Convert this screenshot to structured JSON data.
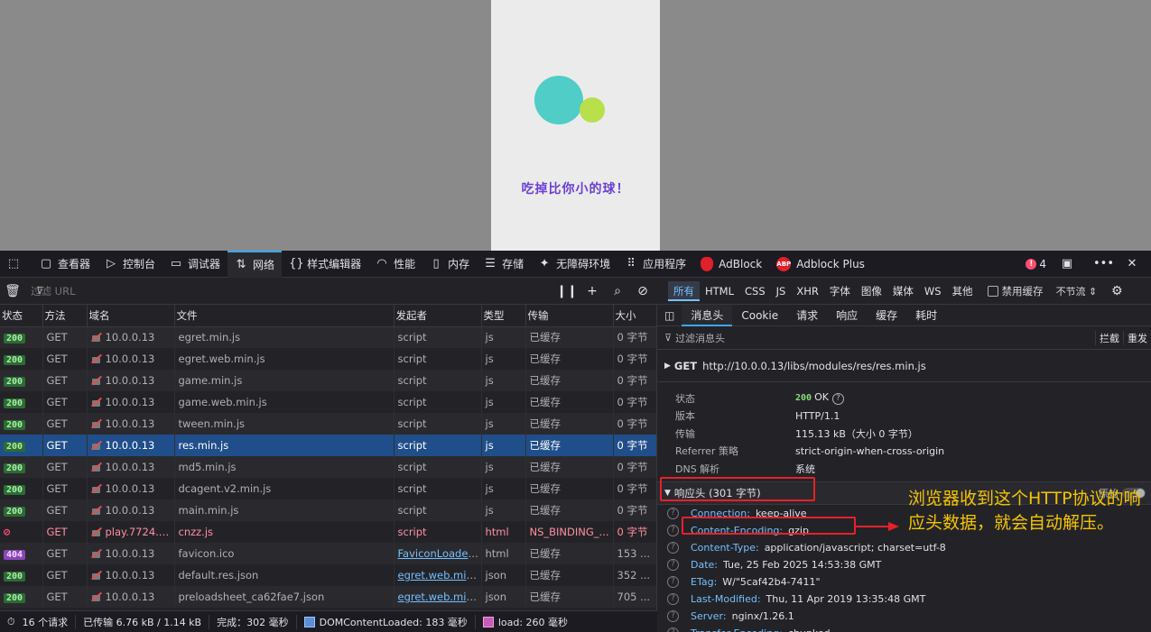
{
  "viewport": {
    "game_caption": "吃掉比你小的球！"
  },
  "toolbar": {
    "items": [
      {
        "label": "查看器",
        "icon": "inspector-icon"
      },
      {
        "label": "控制台",
        "icon": "console-icon"
      },
      {
        "label": "调试器",
        "icon": "debugger-icon"
      },
      {
        "label": "网络",
        "icon": "network-icon"
      },
      {
        "label": "样式编辑器",
        "icon": "style-editor-icon"
      },
      {
        "label": "性能",
        "icon": "performance-icon"
      },
      {
        "label": "内存",
        "icon": "memory-icon"
      },
      {
        "label": "存储",
        "icon": "storage-icon"
      },
      {
        "label": "无障碍环境",
        "icon": "accessibility-icon"
      },
      {
        "label": "应用程序",
        "icon": "application-icon"
      },
      {
        "label": "AdBlock",
        "icon": "adblock-icon"
      },
      {
        "label": "Adblock Plus",
        "icon": "adblock-plus-icon"
      }
    ],
    "abp_badge": "ABP",
    "error_count": "4"
  },
  "filterbar": {
    "placeholder": "过滤 URL",
    "type_tabs": [
      "所有",
      "HTML",
      "CSS",
      "JS",
      "XHR",
      "字体",
      "图像",
      "媒体",
      "WS",
      "其他"
    ],
    "disable_cache_label": "禁用缓存",
    "throttle_label": "不节流 ⇕"
  },
  "table": {
    "columns": [
      "状态",
      "方法",
      "域名",
      "文件",
      "发起者",
      "类型",
      "传输",
      "大小"
    ],
    "rows": [
      {
        "status": "200",
        "method": "GET",
        "domain": "10.0.0.13",
        "file": "egret.min.js",
        "initiator": "script",
        "type": "js",
        "transfer": "已缓存",
        "size": "0 字节"
      },
      {
        "status": "200",
        "method": "GET",
        "domain": "10.0.0.13",
        "file": "egret.web.min.js",
        "initiator": "script",
        "type": "js",
        "transfer": "已缓存",
        "size": "0 字节"
      },
      {
        "status": "200",
        "method": "GET",
        "domain": "10.0.0.13",
        "file": "game.min.js",
        "initiator": "script",
        "type": "js",
        "transfer": "已缓存",
        "size": "0 字节"
      },
      {
        "status": "200",
        "method": "GET",
        "domain": "10.0.0.13",
        "file": "game.web.min.js",
        "initiator": "script",
        "type": "js",
        "transfer": "已缓存",
        "size": "0 字节"
      },
      {
        "status": "200",
        "method": "GET",
        "domain": "10.0.0.13",
        "file": "tween.min.js",
        "initiator": "script",
        "type": "js",
        "transfer": "已缓存",
        "size": "0 字节"
      },
      {
        "status": "200",
        "method": "GET",
        "domain": "10.0.0.13",
        "file": "res.min.js",
        "initiator": "script",
        "type": "js",
        "transfer": "已缓存",
        "size": "0 字节"
      },
      {
        "status": "200",
        "method": "GET",
        "domain": "10.0.0.13",
        "file": "md5.min.js",
        "initiator": "script",
        "type": "js",
        "transfer": "已缓存",
        "size": "0 字节"
      },
      {
        "status": "200",
        "method": "GET",
        "domain": "10.0.0.13",
        "file": "dcagent.v2.min.js",
        "initiator": "script",
        "type": "js",
        "transfer": "已缓存",
        "size": "0 字节"
      },
      {
        "status": "200",
        "method": "GET",
        "domain": "10.0.0.13",
        "file": "main.min.js",
        "initiator": "script",
        "type": "js",
        "transfer": "已缓存",
        "size": "0 字节"
      },
      {
        "status": "blocked",
        "method": "GET",
        "domain": "play.7724.c...",
        "file": "cnzz.js",
        "initiator": "script",
        "type": "html",
        "transfer": "NS_BINDING_...",
        "size": "0 字节"
      },
      {
        "status": "404",
        "method": "GET",
        "domain": "10.0.0.13",
        "file": "favicon.ico",
        "initiator": "FaviconLoader....",
        "type": "html",
        "transfer": "已缓存",
        "size": "153 ..."
      },
      {
        "status": "200",
        "method": "GET",
        "domain": "10.0.0.13",
        "file": "default.res.json",
        "initiator": "egret.web.min....",
        "type": "json",
        "transfer": "已缓存",
        "size": "352 ..."
      },
      {
        "status": "200",
        "method": "GET",
        "domain": "10.0.0.13",
        "file": "preloadsheet_ca62fae7.json",
        "initiator": "egret.web.min....",
        "type": "json",
        "transfer": "已缓存",
        "size": "705 ..."
      }
    ]
  },
  "statusbar": {
    "requests": "16 个请求",
    "transferred": "已传输 6.76 kB / 1.14 kB",
    "finish": "完成：302 毫秒",
    "dom_loaded": "DOMContentLoaded: 183 毫秒",
    "load": "load: 260 毫秒"
  },
  "details": {
    "tabs": [
      "消息头",
      "Cookie",
      "请求",
      "响应",
      "缓存",
      "耗时"
    ],
    "filter_placeholder": "过滤消息头",
    "block_label": "拦截",
    "resend_label": "重发",
    "request_method": "GET",
    "request_url": "http://10.0.0.13/libs/modules/res/res.min.js",
    "summary": [
      {
        "key": "状态",
        "value": "OK",
        "code": "200"
      },
      {
        "key": "版本",
        "value": "HTTP/1.1"
      },
      {
        "key": "传输",
        "value": "115.13 kB（大小 0 字节）"
      },
      {
        "key": "Referrer 策略",
        "value": "strict-origin-when-cross-origin"
      },
      {
        "key": "DNS 解析",
        "value": "系统"
      }
    ],
    "response_header_label": "响应头 (301 字节)",
    "raw_label": "原始",
    "headers": [
      {
        "name": "Connection:",
        "value": "keep-alive"
      },
      {
        "name": "Content-Encoding:",
        "value": "gzip"
      },
      {
        "name": "Content-Type:",
        "value": "application/javascript; charset=utf-8"
      },
      {
        "name": "Date:",
        "value": "Tue, 25 Feb 2025 14:53:38 GMT"
      },
      {
        "name": "ETag:",
        "value": "W/\"5caf42b4-7411\""
      },
      {
        "name": "Last-Modified:",
        "value": "Thu, 11 Apr 2019 13:35:48 GMT"
      },
      {
        "name": "Server:",
        "value": "nginx/1.26.1"
      },
      {
        "name": "Transfer-Encoding:",
        "value": "chunked"
      }
    ]
  },
  "annotation": {
    "text": "浏览器收到这个HTTP协议的响应头数据，就会自动解压。",
    "color": "#f5c400",
    "box_color": "#e8202a"
  }
}
